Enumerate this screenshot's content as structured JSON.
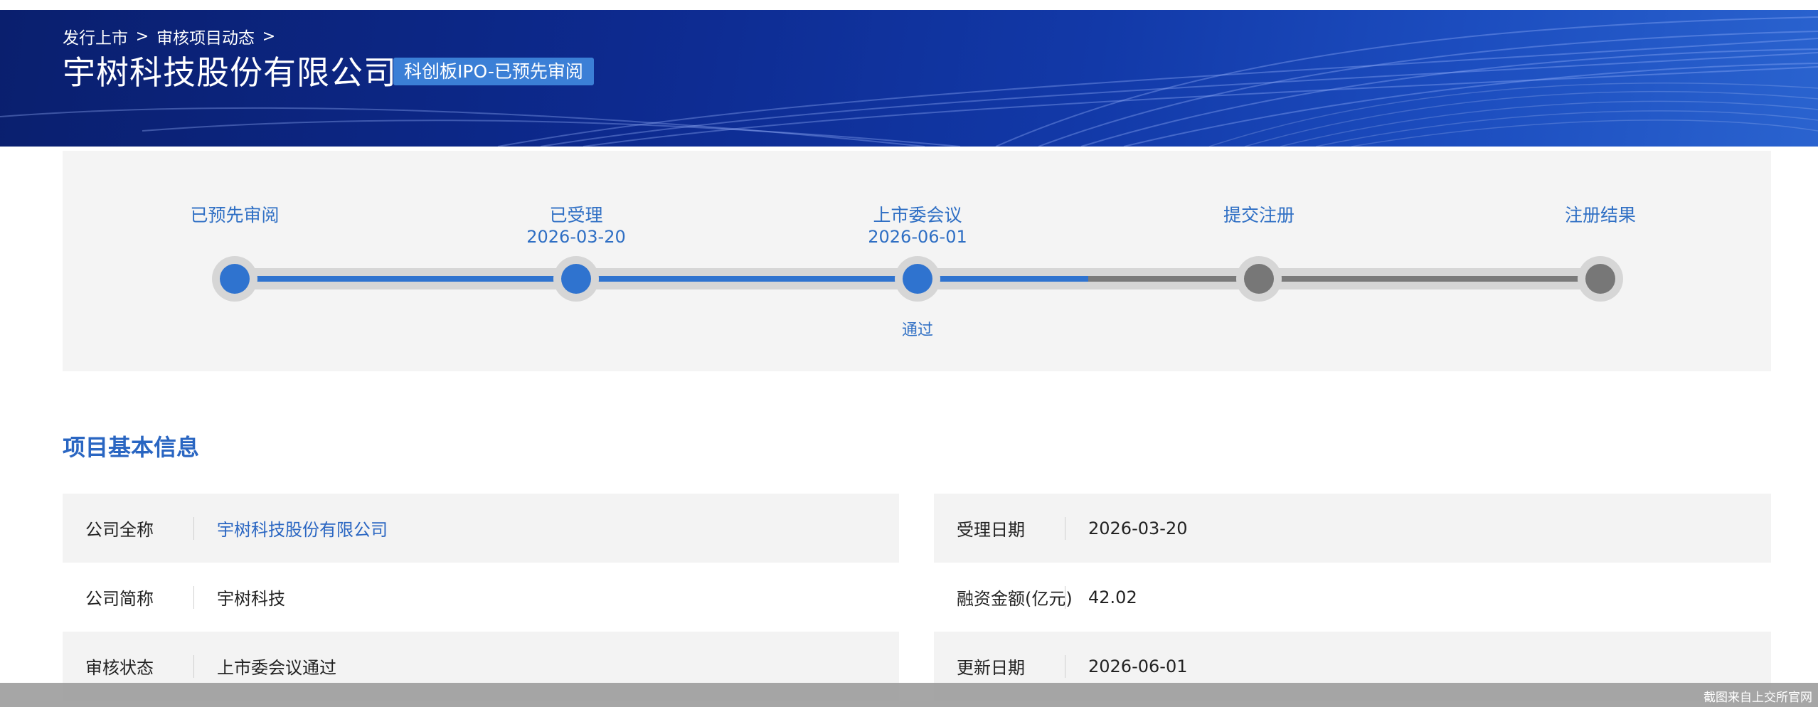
{
  "breadcrumb": [
    "发行上市",
    "审核项目动态"
  ],
  "company_name": "宇树科技股份有限公司",
  "board_badge": "科创板IPO-已预先审阅",
  "steps": [
    {
      "label": "已预先审阅",
      "date": "",
      "status": "done"
    },
    {
      "label": "已受理",
      "date": "2026-03-20",
      "status": "done"
    },
    {
      "label": "上市委会议",
      "date": "2026-06-01",
      "status": "done",
      "result": "通过"
    },
    {
      "label": "提交注册",
      "date": "",
      "status": "todo"
    },
    {
      "label": "注册结果",
      "date": "",
      "status": "todo"
    }
  ],
  "section_title": "项目基本信息",
  "info_left": [
    {
      "label": "公司全称",
      "value": "宇树科技股份有限公司",
      "is_link": true
    },
    {
      "label": "公司简称",
      "value": "宇树科技"
    },
    {
      "label": "审核状态",
      "value": "上市委会议通过"
    }
  ],
  "info_right": [
    {
      "label": "受理日期",
      "value": "2026-03-20"
    },
    {
      "label": "融资金额(亿元)",
      "value": "42.02"
    },
    {
      "label": "更新日期",
      "value": "2026-06-01"
    }
  ],
  "watermark": "截图来自上交所官网",
  "colors": {
    "header_dark": "#0a1f6e",
    "accent_blue": "#2f73cf",
    "pending_gray": "#777777",
    "panel_bg": "#f4f4f4"
  }
}
